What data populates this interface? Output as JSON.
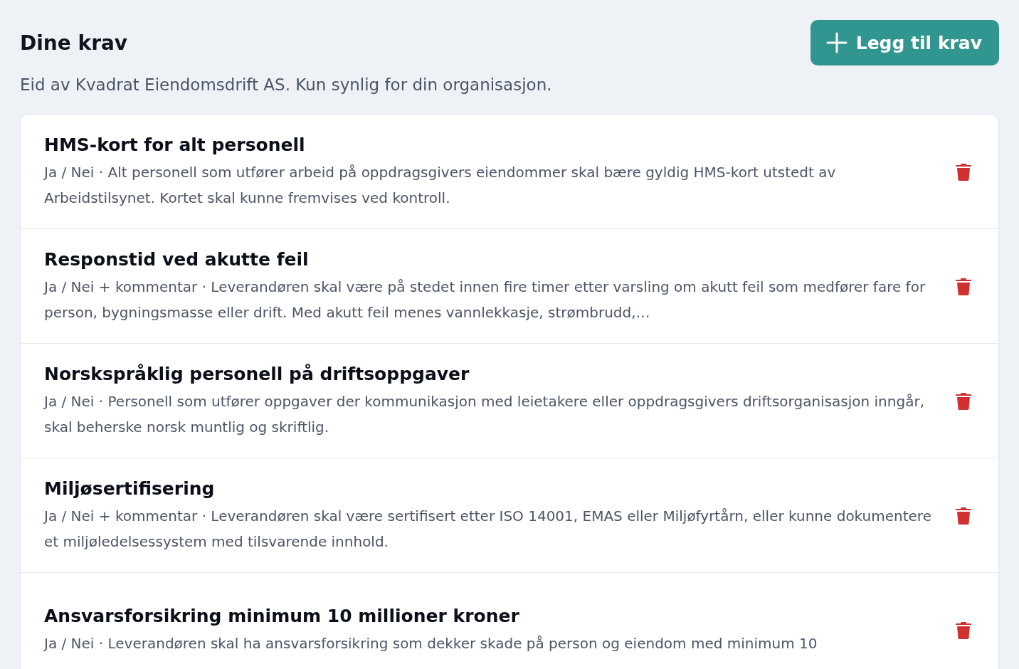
{
  "header": {
    "title": "Dine krav",
    "add_button": "Legg til krav"
  },
  "subtitle": "Eid av Kvadrat Eiendomsdrift AS. Kun synlig for din organisasjon.",
  "requirements": [
    {
      "title": "HMS-kort for alt personell",
      "description": "Ja / Nei · Alt personell som utfører arbeid på oppdragsgivers eiendommer skal bære gyldig HMS-kort utstedt av Arbeidstilsynet. Kortet skal kunne fremvises ved kontroll."
    },
    {
      "title": "Responstid ved akutte feil",
      "description": "Ja / Nei + kommentar · Leverandøren skal være på stedet innen fire timer etter varsling om akutt feil som medfører fare for person, bygningsmasse eller drift. Med akutt feil menes vannlekkasje, strømbrudd,…"
    },
    {
      "title": "Norskspråklig personell på driftsoppgaver",
      "description": "Ja / Nei · Personell som utfører oppgaver der kommunikasjon med leietakere eller oppdragsgivers driftsorganisasjon inngår, skal beherske norsk muntlig og skriftlig."
    },
    {
      "title": "Miljøsertifisering",
      "description": "Ja / Nei + kommentar · Leverandøren skal være sertifisert etter ISO 14001, EMAS eller Miljøfyrtårn, eller kunne dokumentere et miljøledelsessystem med tilsvarende innhold."
    },
    {
      "title": "Ansvarsforsikring minimum 10 millioner kroner",
      "description": "Ja / Nei · Leverandøren skal ha ansvarsforsikring som dekker skade på person og eiendom med minimum 10"
    }
  ]
}
